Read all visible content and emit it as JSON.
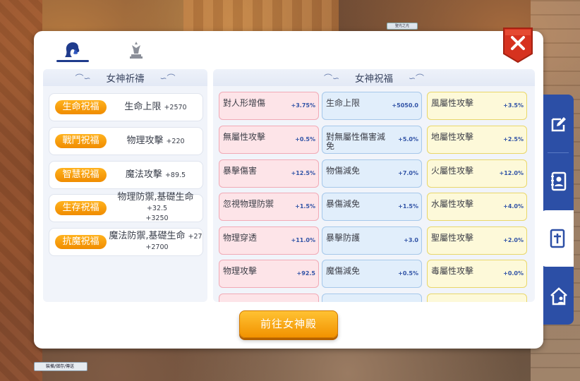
{
  "hud": {
    "top_tag": "聖光之光",
    "bottom_tag": "裝備/儲存/傳送"
  },
  "tabs": [
    {
      "name": "goddess-tab",
      "icon": "goddess-head-icon",
      "active": true
    },
    {
      "name": "statue-tab",
      "icon": "statue-icon",
      "active": false
    }
  ],
  "left": {
    "title": "女神祈禱",
    "rows": [
      {
        "badge": "生命祝福",
        "lines": [
          {
            "stat": "生命上限",
            "value": "+2570"
          }
        ]
      },
      {
        "badge": "戰鬥祝福",
        "lines": [
          {
            "stat": "物理攻擊",
            "value": "+220"
          }
        ]
      },
      {
        "badge": "智慧祝福",
        "lines": [
          {
            "stat": "魔法攻擊",
            "value": "+89.5"
          }
        ]
      },
      {
        "badge": "生存祝福",
        "lines": [
          {
            "stat": "物理防禦,基礎生命",
            "value": "+32.5"
          },
          {
            "stat": "",
            "value": "+3250"
          }
        ]
      },
      {
        "badge": "抗魔祝福",
        "lines": [
          {
            "stat": "魔法防禦,基礎生命",
            "value": "+27"
          },
          {
            "stat": "",
            "value": "+2700"
          }
        ]
      }
    ]
  },
  "right": {
    "title": "女神祝福",
    "columns": [
      {
        "color": "pink",
        "cells": [
          {
            "name": "對人形增傷",
            "value": "+3.75%"
          },
          {
            "name": "無屬性攻擊",
            "value": "+0.5%"
          },
          {
            "name": "暴擊傷害",
            "value": "+12.5%"
          },
          {
            "name": "忽視物理防禦",
            "value": "+1.5%"
          },
          {
            "name": "物理穿透",
            "value": "+11.0%"
          },
          {
            "name": "物理攻擊",
            "value": "+92.5"
          },
          {
            "name": "",
            "value": ""
          }
        ]
      },
      {
        "color": "blue",
        "cells": [
          {
            "name": "生命上限",
            "value": "+5050.0"
          },
          {
            "name": "對無屬性傷害減免",
            "value": "+5.0%"
          },
          {
            "name": "物傷減免",
            "value": "+7.0%"
          },
          {
            "name": "暴傷減免",
            "value": "+1.5%"
          },
          {
            "name": "暴擊防護",
            "value": "+3.0"
          },
          {
            "name": "魔傷減免",
            "value": "+0.5%"
          },
          {
            "name": "",
            "value": ""
          }
        ]
      },
      {
        "color": "yellow",
        "cells": [
          {
            "name": "風屬性攻擊",
            "value": "+3.5%"
          },
          {
            "name": "地屬性攻擊",
            "value": "+2.5%"
          },
          {
            "name": "火屬性攻擊",
            "value": "+12.0%"
          },
          {
            "name": "水屬性攻擊",
            "value": "+4.0%"
          },
          {
            "name": "聖屬性攻擊",
            "value": "+2.0%"
          },
          {
            "name": "毒屬性攻擊",
            "value": "+0.0%"
          },
          {
            "name": "",
            "value": ""
          }
        ]
      }
    ]
  },
  "goto_button": "前往女神殿",
  "side_nav": [
    {
      "name": "side-nav-edit",
      "icon": "edit-icon",
      "active": false
    },
    {
      "name": "side-nav-contacts",
      "icon": "contact-book-icon",
      "active": false
    },
    {
      "name": "side-nav-goddess",
      "icon": "holy-book-icon",
      "active": true
    },
    {
      "name": "side-nav-home",
      "icon": "home-user-icon",
      "active": false
    }
  ],
  "colors": {
    "accent_orange": "#f29200",
    "nav_blue": "#2c4fa6",
    "close_red": "#e03a28",
    "value_blue": "#3153a6"
  }
}
